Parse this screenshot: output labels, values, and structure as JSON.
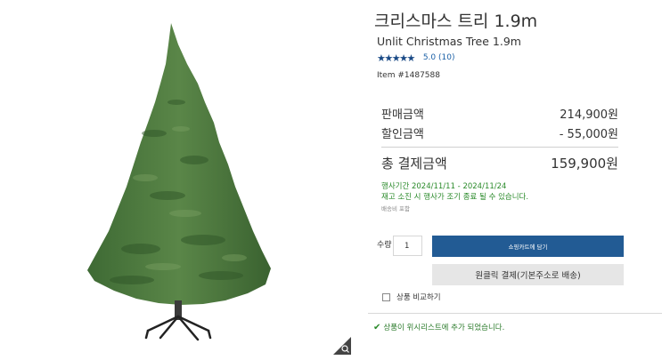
{
  "product": {
    "title_ko": "크리스마스 트리 1.9m",
    "title_en": "Unlit Christmas Tree 1.9m",
    "stars": "★★★★★",
    "rating_text": "5.0 (10)",
    "item_number": "Item #1487588"
  },
  "pricing": {
    "sale_label": "판매금액",
    "sale_value": "214,900원",
    "discount_label": "할인금액",
    "discount_value": "- 55,000원",
    "total_label": "총 결제금액",
    "total_value": "159,900원",
    "event_period": "행사기간 2024/11/11 - 2024/11/24",
    "event_note": "재고 소진 시 행사가 조기 종료 될 수 있습니다.",
    "shipping_note": "배송비 포함"
  },
  "purchase": {
    "quantity_label": "수량",
    "quantity_value": "1",
    "add_to_cart": "쇼핑카트에 담기",
    "one_click": "원클릭 결제(기본주소로 배송)",
    "compare_label": "상품 비교하기"
  },
  "notification": {
    "wishlist_added": "상품이 위시리스트에 추가 되었습니다."
  },
  "colors": {
    "primary_button": "#225b94",
    "success_green": "#2a8a2a",
    "star_color": "#1a4a86",
    "tree_green": "#4f7a3f"
  },
  "icons": [
    "zoom-icon",
    "star-icon",
    "check-icon"
  ]
}
